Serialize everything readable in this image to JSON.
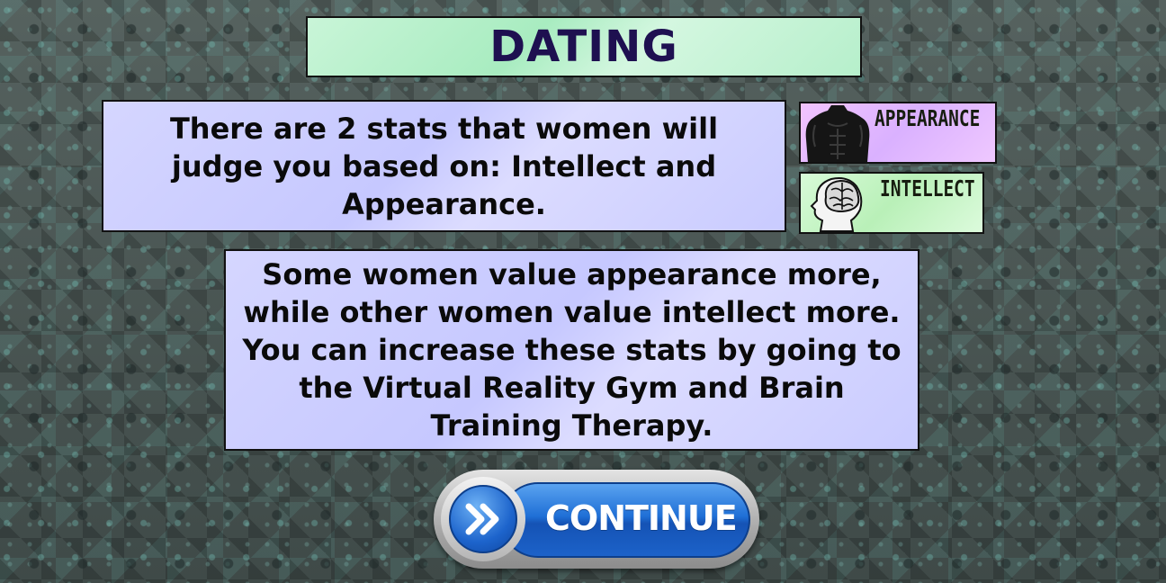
{
  "title": "DATING",
  "intro_text": "There are 2 stats that women will judge you based on: Intellect and Appearance.",
  "detail_text": "Some women value appearance more, while other women value intellect more. You can increase these stats by going to the Virtual Reality Gym and Brain Training Therapy.",
  "stats": {
    "appearance": {
      "label": "APPEARANCE",
      "icon": "muscular-torso-icon"
    },
    "intellect": {
      "label": "INTELLECT",
      "icon": "brain-head-icon"
    }
  },
  "continue_button": {
    "label": "CONTINUE",
    "icon": "double-chevron-right-icon"
  },
  "colors": {
    "title_text": "#1e1050",
    "title_panel": "#b6efcb",
    "text_panel": "#c9cbff",
    "appearance_badge": "#dab1ff",
    "intellect_badge": "#b9f0b8",
    "button_blue": "#1f6fd6"
  }
}
